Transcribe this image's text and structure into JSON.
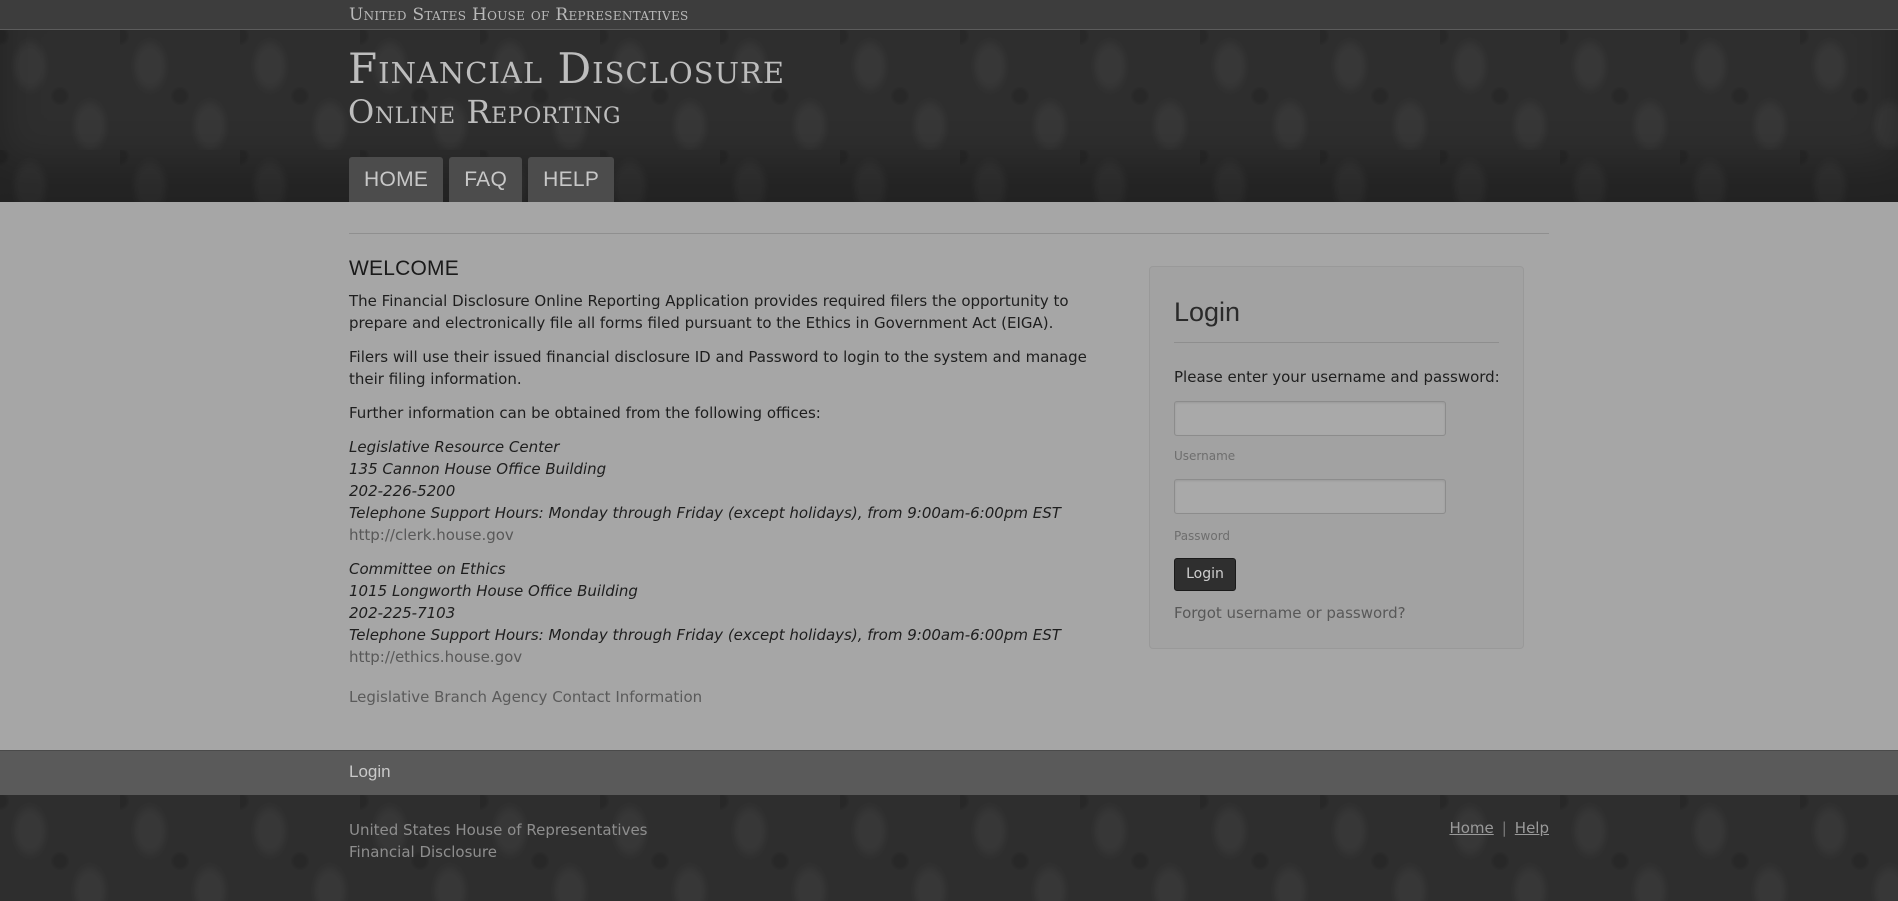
{
  "topbar": {
    "text": "United States House of Representatives"
  },
  "header": {
    "title_line1": "Financial Disclosure",
    "title_line2": "Online Reporting"
  },
  "nav": [
    {
      "label": "HOME"
    },
    {
      "label": "FAQ"
    },
    {
      "label": "HELP"
    }
  ],
  "welcome": {
    "heading": "WELCOME",
    "para1": "The Financial Disclosure Online Reporting Application provides required filers the opportunity to prepare and electronically file all forms filed pursuant to the Ethics in Government Act (EIGA).",
    "para2": "Filers will use their issued financial disclosure ID and Password to login to the system and manage their filing information.",
    "para3": "Further information can be obtained from the following offices:",
    "offices": [
      {
        "name": "Legislative Resource Center",
        "address": "135 Cannon House Office Building",
        "phone": "202-226-5200",
        "hours": "Telephone Support Hours: Monday through Friday (except holidays), from 9:00am-6:00pm EST",
        "url": "http://clerk.house.gov"
      },
      {
        "name": "Committee on Ethics",
        "address": "1015 Longworth House Office Building",
        "phone": "202-225-7103",
        "hours": "Telephone Support Hours: Monday through Friday (except holidays), from 9:00am-6:00pm EST",
        "url": "http://ethics.house.gov"
      }
    ],
    "agency_link": "Legislative Branch Agency Contact Information"
  },
  "login": {
    "title": "Login",
    "prompt": "Please enter your username and password:",
    "username_label": "Username",
    "password_label": "Password",
    "username_value": "",
    "password_value": "",
    "button": "Login",
    "forgot": "Forgot username or password?"
  },
  "breadcrumb": {
    "current": "Login"
  },
  "footer": {
    "line1": "United States House of Representatives",
    "line2": "Financial Disclosure",
    "links": {
      "home": "Home",
      "separator": "|",
      "help": "Help"
    }
  }
}
